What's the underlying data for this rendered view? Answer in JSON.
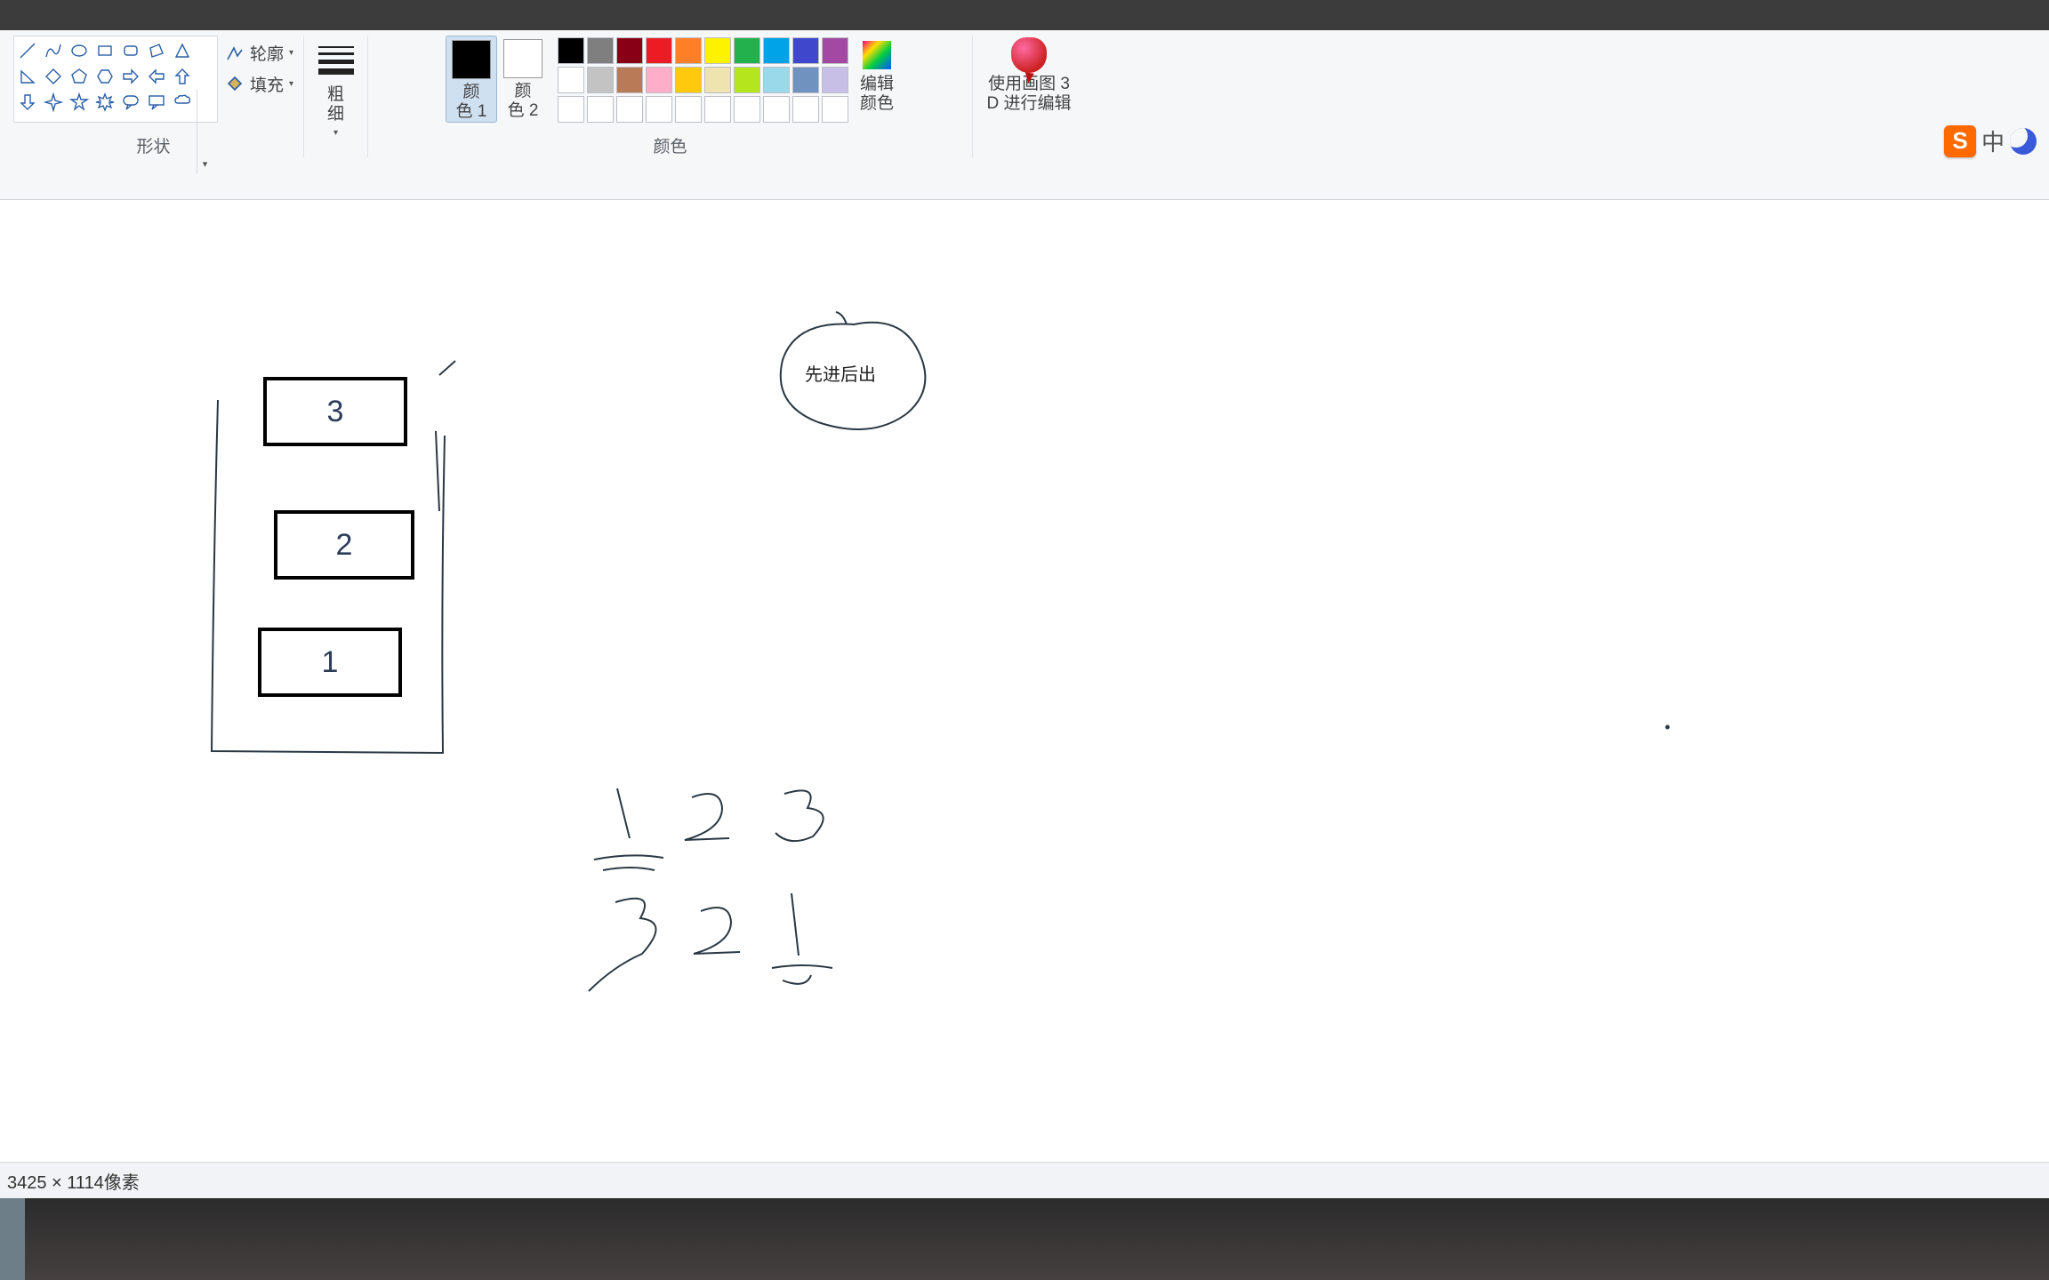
{
  "ribbon": {
    "shapes": {
      "group_label": "形状",
      "outline_label": "轮廓",
      "fill_label": "填充"
    },
    "stroke": {
      "label": "粗\n细"
    },
    "color1": {
      "label": "颜\n色 1",
      "hex": "#000000"
    },
    "color2": {
      "label": "颜\n色 2",
      "hex": "#ffffff"
    },
    "colors_group_label": "颜色",
    "palette_row1": [
      "#000000",
      "#7f7f7f",
      "#880015",
      "#ed1c24",
      "#ff7f27",
      "#fff200",
      "#22b14c",
      "#00a2e8",
      "#3f48cc",
      "#a349a4"
    ],
    "palette_row2": [
      "#ffffff",
      "#c3c3c3",
      "#b97a57",
      "#ffaec9",
      "#ffc90e",
      "#efe4b0",
      "#b5e61d",
      "#99d9ea",
      "#7092be",
      "#c8bfe7"
    ],
    "palette_row3": [
      "#ffffff",
      "#ffffff",
      "#ffffff",
      "#ffffff",
      "#ffffff",
      "#ffffff",
      "#ffffff",
      "#ffffff",
      "#ffffff",
      "#ffffff"
    ],
    "edit_colors_label": "编辑\n颜色",
    "paint3d_label": "使用画图 3\nD 进行编辑"
  },
  "ime": {
    "s": "S",
    "zh": "中"
  },
  "canvas": {
    "box_values": [
      "3",
      "2",
      "1"
    ],
    "bubble_text": "先进后出",
    "sequence_top": [
      "1",
      "2",
      "3"
    ],
    "sequence_bottom": [
      "3",
      "2",
      "1"
    ]
  },
  "statusbar": {
    "size_text": "3425 × 1114像素"
  }
}
